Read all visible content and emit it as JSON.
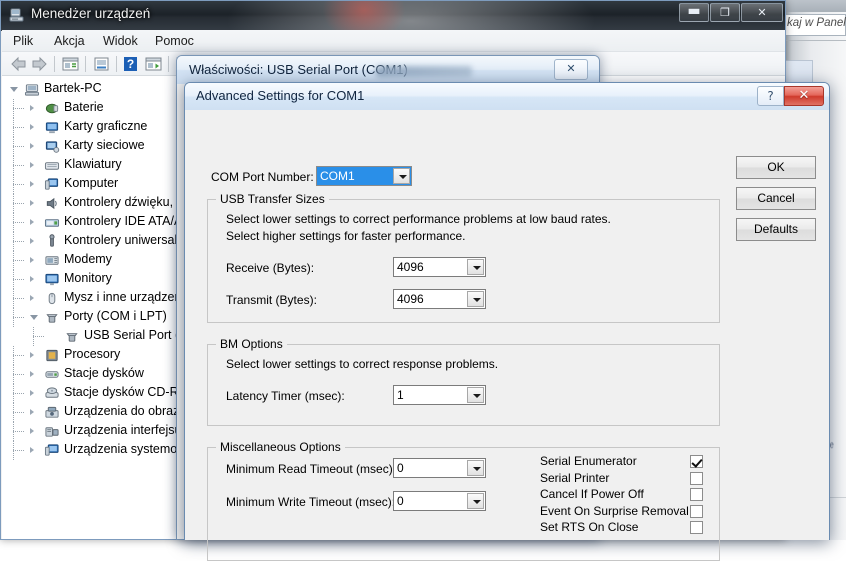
{
  "background": {
    "search_placeholder": "kaj w Panel",
    "side_text": "ne"
  },
  "device_manager": {
    "title": "Menedżer urządzeń",
    "icon": "device-manager-icon",
    "window_buttons": [
      {
        "name": "minimize",
        "glyph": "▬"
      },
      {
        "name": "maximize",
        "glyph": "❐"
      },
      {
        "name": "close",
        "glyph": "✕"
      }
    ],
    "menu": [
      "Plik",
      "Akcja",
      "Widok",
      "Pomoc"
    ],
    "toolbar_icons": [
      "back-arrow-icon",
      "forward-arrow-icon",
      "properties-icon",
      "update-driver-icon",
      "help-icon",
      "scan-hardware-icon"
    ],
    "tree": [
      {
        "label": "Bartek-PC",
        "depth": 0,
        "expander": "open",
        "icon": "computer-icon"
      },
      {
        "label": "Baterie",
        "depth": 1,
        "expander": "collapsed",
        "icon": "battery-icon"
      },
      {
        "label": "Karty graficzne",
        "depth": 1,
        "expander": "collapsed",
        "icon": "display-adapter-icon"
      },
      {
        "label": "Karty sieciowe",
        "depth": 1,
        "expander": "collapsed",
        "icon": "network-adapter-icon"
      },
      {
        "label": "Klawiatury",
        "depth": 1,
        "expander": "collapsed",
        "icon": "keyboard-icon"
      },
      {
        "label": "Komputer",
        "depth": 1,
        "expander": "collapsed",
        "icon": "computer-node-icon"
      },
      {
        "label": "Kontrolery dźwięku, w",
        "depth": 1,
        "expander": "collapsed",
        "icon": "sound-icon"
      },
      {
        "label": "Kontrolery IDE ATA/A",
        "depth": 1,
        "expander": "collapsed",
        "icon": "ide-controller-icon"
      },
      {
        "label": "Kontrolery uniwersaln",
        "depth": 1,
        "expander": "collapsed",
        "icon": "usb-controller-icon"
      },
      {
        "label": "Modemy",
        "depth": 1,
        "expander": "collapsed",
        "icon": "modem-icon"
      },
      {
        "label": "Monitory",
        "depth": 1,
        "expander": "collapsed",
        "icon": "monitor-icon"
      },
      {
        "label": "Mysz i inne urządzeni",
        "depth": 1,
        "expander": "collapsed",
        "icon": "mouse-icon"
      },
      {
        "label": "Porty (COM i LPT)",
        "depth": 1,
        "expander": "open",
        "icon": "port-icon"
      },
      {
        "label": "USB Serial Port (CO",
        "depth": 2,
        "expander": "none",
        "icon": "serial-port-icon"
      },
      {
        "label": "Procesory",
        "depth": 1,
        "expander": "collapsed",
        "icon": "processor-icon"
      },
      {
        "label": "Stacje dysków",
        "depth": 1,
        "expander": "collapsed",
        "icon": "disk-drive-icon"
      },
      {
        "label": "Stacje dysków CD-RO",
        "depth": 1,
        "expander": "collapsed",
        "icon": "cdrom-icon"
      },
      {
        "label": "Urządzenia do obrazo",
        "depth": 1,
        "expander": "collapsed",
        "icon": "imaging-device-icon"
      },
      {
        "label": "Urządzenia interfejsu l",
        "depth": 1,
        "expander": "collapsed",
        "icon": "hid-device-icon"
      },
      {
        "label": "Urządzenia systemow",
        "depth": 1,
        "expander": "collapsed",
        "icon": "system-device-icon"
      }
    ]
  },
  "properties_dialog": {
    "title": "Właściwości: USB Serial Port (COM1)",
    "close_glyph": "✕"
  },
  "advanced_dialog": {
    "title": "Advanced Settings for COM1",
    "help_glyph": "?",
    "close_glyph": "✕",
    "com_port": {
      "label": "COM Port Number:",
      "value": "COM1"
    },
    "usb_transfer_sizes": {
      "title": "USB Transfer Sizes",
      "hint_line1": "Select lower settings to correct performance problems at low baud rates.",
      "hint_line2": "Select higher settings for faster performance.",
      "receive": {
        "label": "Receive (Bytes):",
        "value": "4096"
      },
      "transmit": {
        "label": "Transmit (Bytes):",
        "value": "4096"
      }
    },
    "bm_options": {
      "title": "BM Options",
      "hint": "Select lower settings to correct response problems.",
      "latency": {
        "label": "Latency Timer (msec):",
        "value": "1"
      }
    },
    "misc_options": {
      "title": "Miscellaneous Options",
      "read_timeout": {
        "label": "Minimum Read Timeout (msec):",
        "value": "0"
      },
      "write_timeout": {
        "label": "Minimum Write Timeout (msec):",
        "value": "0"
      },
      "checkboxes": [
        {
          "label": "Serial Enumerator",
          "checked": true
        },
        {
          "label": "Serial Printer",
          "checked": false
        },
        {
          "label": "Cancel If Power Off",
          "checked": false
        },
        {
          "label": "Event On Surprise Removal",
          "checked": false
        },
        {
          "label": "Set RTS On Close",
          "checked": false
        }
      ]
    },
    "buttons": {
      "ok": "OK",
      "cancel": "Cancel",
      "defaults": "Defaults"
    }
  }
}
